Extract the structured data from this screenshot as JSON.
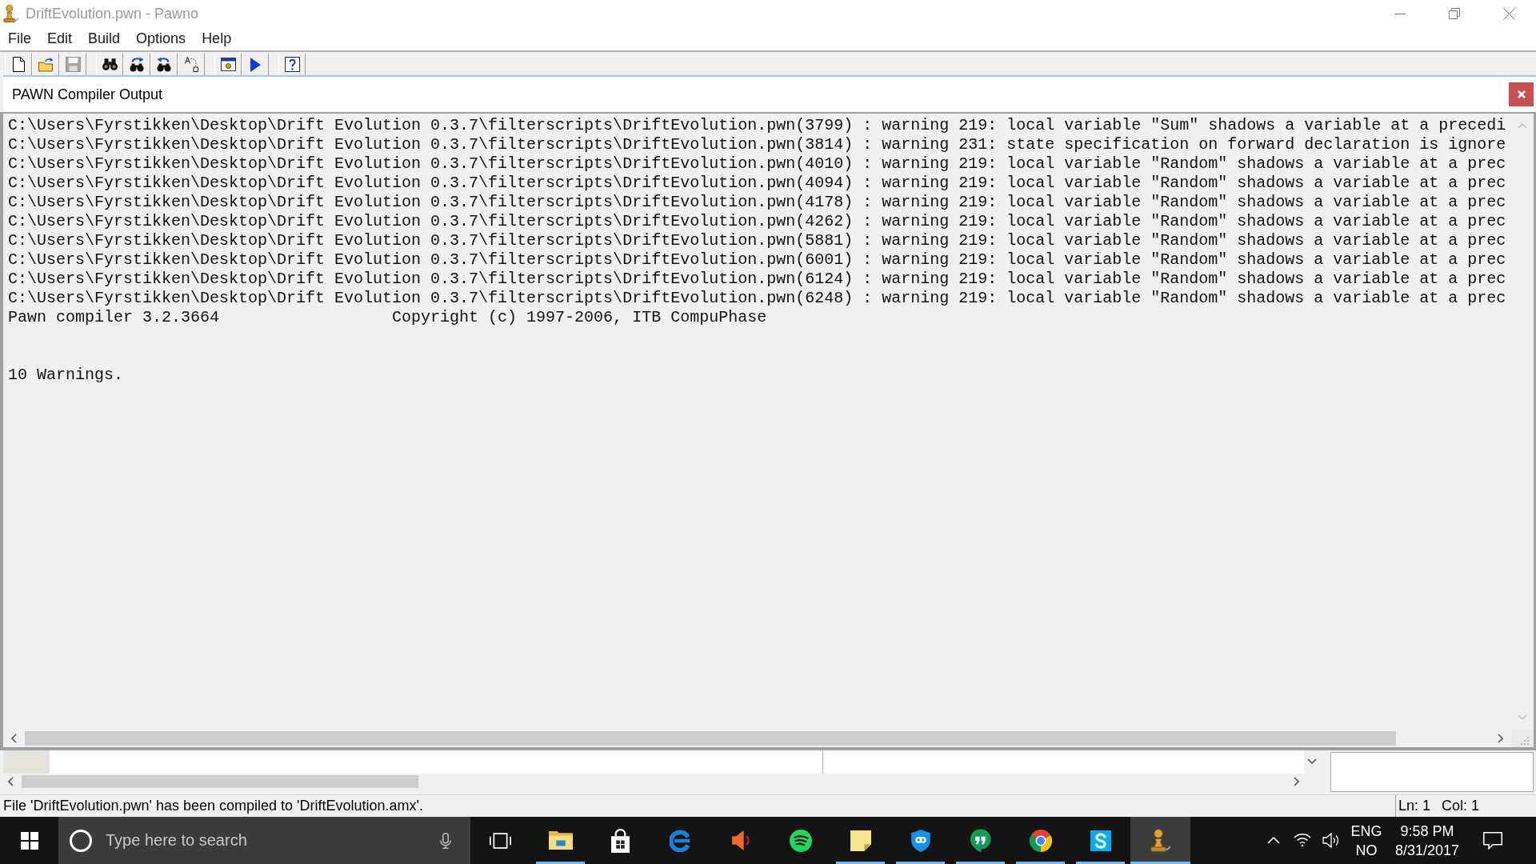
{
  "window": {
    "title": "DriftEvolution.pwn - Pawno"
  },
  "menu": [
    "File",
    "Edit",
    "Build",
    "Options",
    "Help"
  ],
  "toolbar": {
    "groups": [
      {
        "buttons": [
          {
            "kind": "new",
            "disabled": false
          },
          {
            "kind": "open",
            "disabled": false
          },
          {
            "kind": "save",
            "disabled": true
          }
        ]
      },
      {
        "buttons": [
          {
            "kind": "find",
            "disabled": false
          },
          {
            "kind": "find-next",
            "disabled": false
          },
          {
            "kind": "replace",
            "disabled": false
          },
          {
            "kind": "letters",
            "disabled": false
          }
        ]
      },
      {
        "buttons": [
          {
            "kind": "window",
            "disabled": false
          },
          {
            "kind": "run",
            "disabled": false
          }
        ]
      },
      {
        "buttons": [
          {
            "kind": "help",
            "disabled": false
          }
        ]
      }
    ]
  },
  "output_panel": {
    "title": "PAWN Compiler Output",
    "messages": [
      "C:\\Users\\Fyrstikken\\Desktop\\Drift Evolution 0.3.7\\filterscripts\\DriftEvolution.pwn(3799) : warning 219: local variable \"Sum\" shadows a variable at a precedi",
      "C:\\Users\\Fyrstikken\\Desktop\\Drift Evolution 0.3.7\\filterscripts\\DriftEvolution.pwn(3814) : warning 231: state specification on forward declaration is ignore",
      "C:\\Users\\Fyrstikken\\Desktop\\Drift Evolution 0.3.7\\filterscripts\\DriftEvolution.pwn(4010) : warning 219: local variable \"Random\" shadows a variable at a prec",
      "C:\\Users\\Fyrstikken\\Desktop\\Drift Evolution 0.3.7\\filterscripts\\DriftEvolution.pwn(4094) : warning 219: local variable \"Random\" shadows a variable at a prec",
      "C:\\Users\\Fyrstikken\\Desktop\\Drift Evolution 0.3.7\\filterscripts\\DriftEvolution.pwn(4178) : warning 219: local variable \"Random\" shadows a variable at a prec",
      "C:\\Users\\Fyrstikken\\Desktop\\Drift Evolution 0.3.7\\filterscripts\\DriftEvolution.pwn(4262) : warning 219: local variable \"Random\" shadows a variable at a prec",
      "C:\\Users\\Fyrstikken\\Desktop\\Drift Evolution 0.3.7\\filterscripts\\DriftEvolution.pwn(5881) : warning 219: local variable \"Random\" shadows a variable at a prec",
      "C:\\Users\\Fyrstikken\\Desktop\\Drift Evolution 0.3.7\\filterscripts\\DriftEvolution.pwn(6001) : warning 219: local variable \"Random\" shadows a variable at a prec",
      "C:\\Users\\Fyrstikken\\Desktop\\Drift Evolution 0.3.7\\filterscripts\\DriftEvolution.pwn(6124) : warning 219: local variable \"Random\" shadows a variable at a prec",
      "C:\\Users\\Fyrstikken\\Desktop\\Drift Evolution 0.3.7\\filterscripts\\DriftEvolution.pwn(6248) : warning 219: local variable \"Random\" shadows a variable at a prec"
    ],
    "compiler_version": "Pawn compiler 3.2.3664",
    "copyright": "Copyright (c) 1997-2006, ITB CompuPhase",
    "summary": "10 Warnings."
  },
  "status_bar": {
    "message": "File 'DriftEvolution.pwn' has been compiled to 'DriftEvolution.amx'.",
    "line": "Ln: 1",
    "column": "Col: 1"
  },
  "taskbar": {
    "search": {
      "placeholder": "Type here to search"
    },
    "apps": [
      {
        "kind": "folder",
        "running": true,
        "active": false
      },
      {
        "kind": "bag",
        "running": false,
        "active": false
      },
      {
        "kind": "swirl",
        "running": false,
        "active": false
      },
      {
        "kind": "speaker",
        "running": false,
        "active": false
      },
      {
        "kind": "waves",
        "running": false,
        "active": false
      },
      {
        "kind": "note",
        "running": true,
        "active": false
      },
      {
        "kind": "shield",
        "running": true,
        "active": false
      },
      {
        "kind": "quotes",
        "running": true,
        "active": false
      },
      {
        "kind": "ring",
        "running": true,
        "active": false
      },
      {
        "kind": "sbadge",
        "running": true,
        "active": false
      },
      {
        "kind": "pawn",
        "running": true,
        "active": true
      }
    ],
    "language": "ENG",
    "keyboard": "NO",
    "time": "9:58 PM",
    "date": "8/31/2017"
  }
}
